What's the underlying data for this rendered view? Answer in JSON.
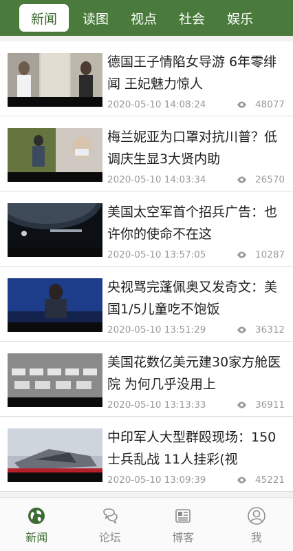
{
  "top_tabs": [
    {
      "label": "新闻"
    },
    {
      "label": "读图"
    },
    {
      "label": "视点"
    },
    {
      "label": "社会"
    },
    {
      "label": "娱乐"
    }
  ],
  "news": [
    {
      "title": "德国王子情陷女导游 6年零绯闻 王妃魅力惊人",
      "date": "2020-05-10 14:08:24",
      "views": "48077",
      "thumb_colors": [
        "#d9d6cf",
        "#6b6b6b",
        "#bfb9ad"
      ]
    },
    {
      "title": "梅兰妮亚为口罩对抗川普？低调庆生显3大贤内助",
      "date": "2020-05-10 14:03:34",
      "views": "26570",
      "thumb_colors": [
        "#5b6b3e",
        "#2f3a2a",
        "#c9c3bb"
      ]
    },
    {
      "title": "美国太空军首个招兵广告：也许你的使命不在这",
      "date": "2020-05-10 13:57:05",
      "views": "10287",
      "thumb_colors": [
        "#0c1014",
        "#3a4452",
        "#a8b0b8"
      ]
    },
    {
      "title": "央视骂完蓬佩奥又发奇文：美国1/5儿童吃不饱饭",
      "date": "2020-05-10 13:51:29",
      "views": "36312",
      "thumb_colors": [
        "#1d3d8a",
        "#2a2f3f",
        "#d8d8d8"
      ]
    },
    {
      "title": "美国花数亿美元建30家方舱医院 为何几乎没用上",
      "date": "2020-05-10 13:13:33",
      "views": "36911",
      "thumb_colors": [
        "#8a8a8a",
        "#e6e6e6",
        "#555555"
      ]
    },
    {
      "title": "中印军人大型群殴现场：150士兵乱战 11人挂彩(视",
      "date": "2020-05-10 13:09:39",
      "views": "45221",
      "thumb_colors": [
        "#9aa3b0",
        "#cfd5dd",
        "#b6202a"
      ]
    }
  ],
  "bottom_nav": [
    {
      "label": "新闻",
      "icon": "globe-icon"
    },
    {
      "label": "论坛",
      "icon": "chat-icon"
    },
    {
      "label": "博客",
      "icon": "newspaper-icon"
    },
    {
      "label": "我",
      "icon": "user-icon"
    }
  ],
  "colors": {
    "brand": "#4a7a3c",
    "active_text": "#3e6b33"
  }
}
